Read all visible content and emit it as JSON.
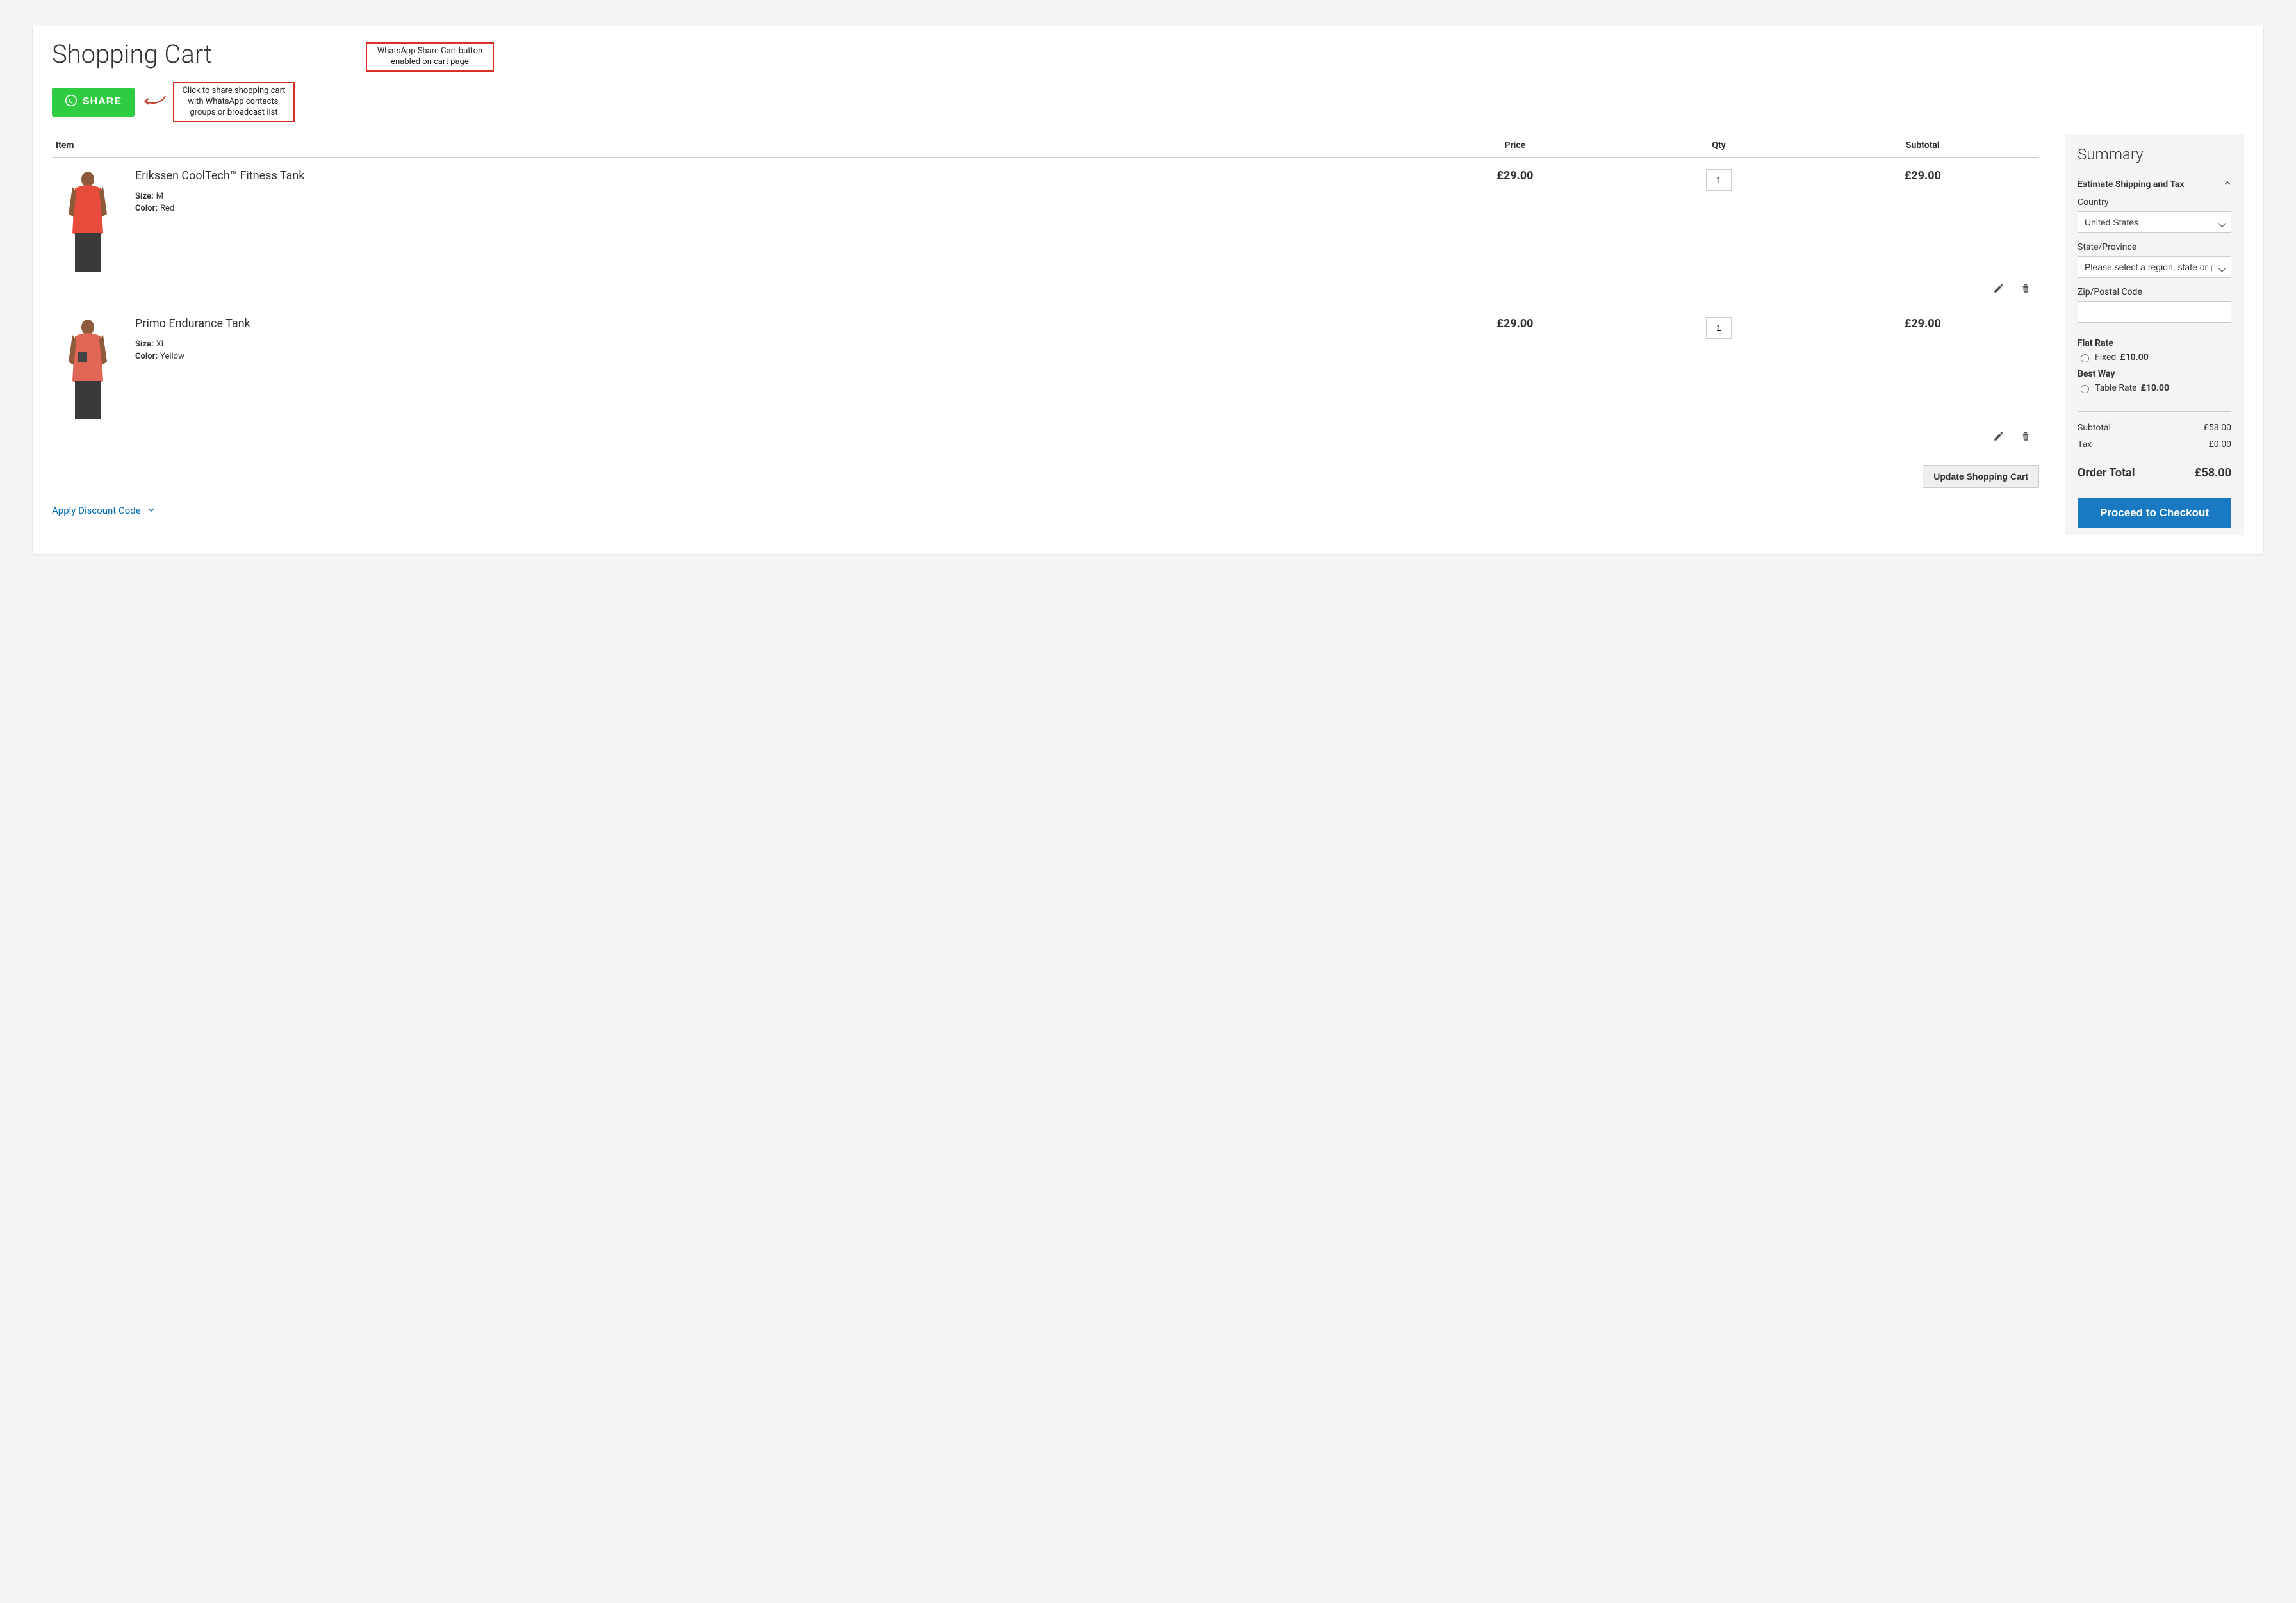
{
  "page_title": "Shopping Cart",
  "annotations": {
    "top": "WhatsApp Share Cart button enabled on cart page",
    "share": "Click to share shopping cart with WhatsApp contacts, groups or broadcast list"
  },
  "share_button_label": "SHARE",
  "table": {
    "headers": {
      "item": "Item",
      "price": "Price",
      "qty": "Qty",
      "subtotal": "Subtotal"
    }
  },
  "items": [
    {
      "name": "Erikssen CoolTech™ Fitness Tank",
      "attrs": {
        "size_label": "Size:",
        "size": "M",
        "color_label": "Color:",
        "color": "Red"
      },
      "price": "£29.00",
      "qty": "1",
      "subtotal": "£29.00"
    },
    {
      "name": "Primo Endurance Tank",
      "attrs": {
        "size_label": "Size:",
        "size": "XL",
        "color_label": "Color:",
        "color": "Yellow"
      },
      "price": "£29.00",
      "qty": "1",
      "subtotal": "£29.00"
    }
  ],
  "update_cart_label": "Update Shopping Cart",
  "discount_label": "Apply Discount Code",
  "summary": {
    "title": "Summary",
    "estimate_label": "Estimate Shipping and Tax",
    "country_label": "Country",
    "country_value": "United States",
    "state_label": "State/Province",
    "state_placeholder": "Please select a region, state or province",
    "zip_label": "Zip/Postal Code",
    "zip_value": "",
    "methods": [
      {
        "title": "Flat Rate",
        "option_label": "Fixed",
        "price": "£10.00"
      },
      {
        "title": "Best Way",
        "option_label": "Table Rate",
        "price": "£10.00"
      }
    ],
    "subtotal_label": "Subtotal",
    "subtotal_value": "£58.00",
    "tax_label": "Tax",
    "tax_value": "£0.00",
    "order_total_label": "Order Total",
    "order_total_value": "£58.00",
    "checkout_label": "Proceed to Checkout"
  }
}
